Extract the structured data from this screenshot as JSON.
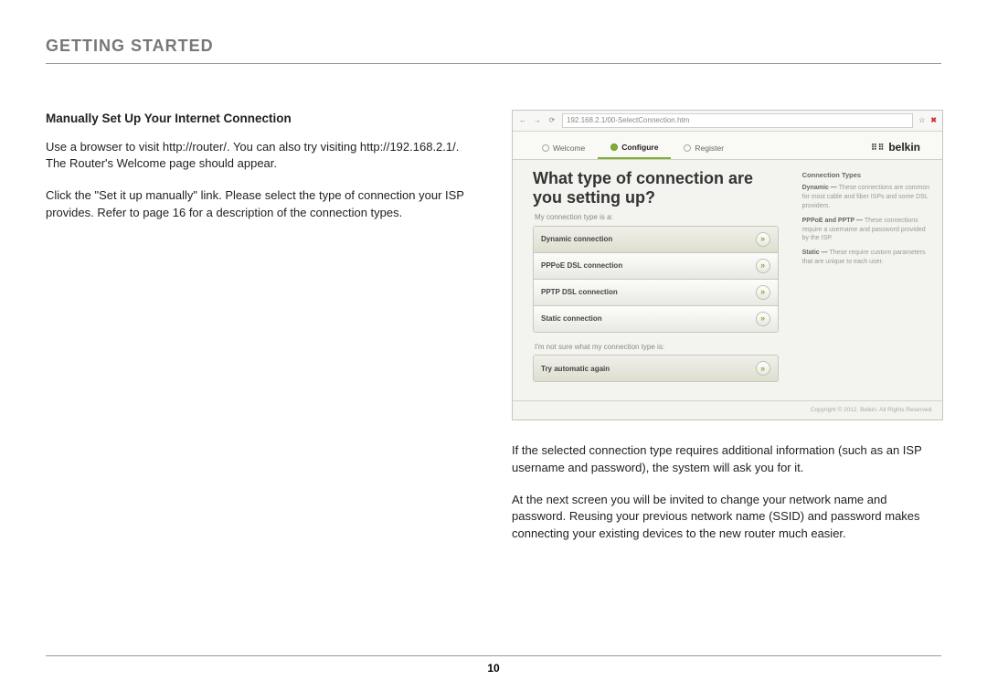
{
  "section_title": "GETTING STARTED",
  "left": {
    "subhead": "Manually Set Up Your Internet Connection",
    "p1": "Use a browser to visit http://router/. You can also try visiting http://192.168.2.1/. The Router's Welcome page should appear.",
    "p2": "Click the \"Set it up manually\" link. Please select the type of connection your ISP provides. Refer to page 16 for a description of the connection types."
  },
  "right": {
    "p1": "If the selected connection type requires additional information (such as an ISP username and password), the system will ask you for it.",
    "p2": "At the next screen you will be invited to change your network name and password. Reusing your previous network name (SSID) and password makes connecting your existing devices to the new router much easier."
  },
  "shot": {
    "url": "192.168.2.1/00-SelectConnection.htm",
    "star": "☆",
    "tabs": {
      "t1": "Welcome",
      "t2": "Configure",
      "t3": "Register"
    },
    "brand": "belkin",
    "heading": "What type of connection are you setting up?",
    "sub1": "My connection type is a:",
    "opts": {
      "o1": "Dynamic connection",
      "o2": "PPPoE DSL connection",
      "o3": "PPTP DSL connection",
      "o4": "Static connection"
    },
    "sub2": "I'm not sure what my connection type is:",
    "opt_auto": "Try automatic again",
    "side": {
      "title": "Connection Types",
      "i1b": "Dynamic —",
      "i1": " These connections are common for most cable and fiber ISPs and some DSL providers.",
      "i2b": "PPPoE and PPTP —",
      "i2": " These connections require a username and password provided by the ISP.",
      "i3b": "Static —",
      "i3": " These require custom parameters that are unique to each user."
    },
    "footer": "Copyright © 2012. Belkin. All Rights Reserved."
  },
  "page_number": "10"
}
